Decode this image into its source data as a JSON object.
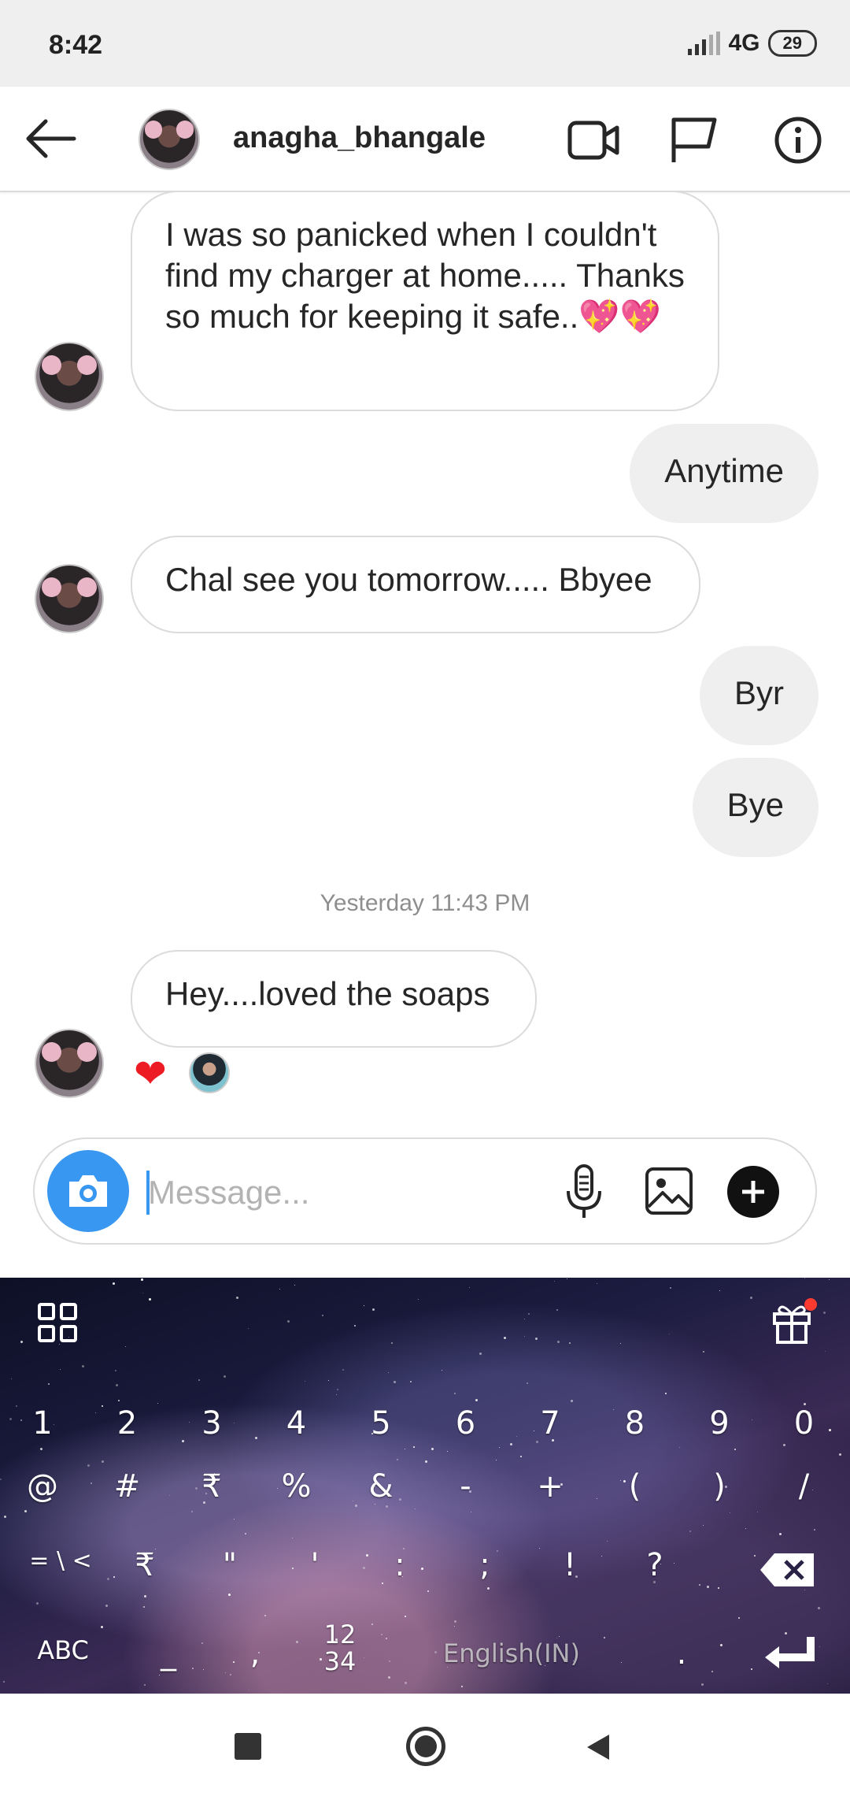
{
  "status_bar": {
    "time": "8:42",
    "network": "4G",
    "battery": "29"
  },
  "header": {
    "username": "anagha_bhangale"
  },
  "messages": [
    {
      "from": "them",
      "text": "I was so panicked when I couldn't find my charger at home..... Thanks so much for keeping it safe..💖💖"
    },
    {
      "from": "me",
      "text": "Anytime"
    },
    {
      "from": "them",
      "text": "Chal see you tomorrow..... Bbyee"
    },
    {
      "from": "me",
      "text": "Byr"
    },
    {
      "from": "me",
      "text": "Bye"
    },
    {
      "from": "them",
      "text": "Hey....loved the soaps"
    }
  ],
  "timestamp": "Yesterday 11:43 PM",
  "reaction": {
    "emoji": "❤"
  },
  "composer": {
    "placeholder": "Message..."
  },
  "keyboard": {
    "row_numbers": [
      "1",
      "2",
      "3",
      "4",
      "5",
      "6",
      "7",
      "8",
      "9",
      "0"
    ],
    "row_symbols1": [
      "@",
      "#",
      "₹",
      "%",
      "&",
      "-",
      "+",
      "(",
      ")",
      "/"
    ],
    "row_symbols2": [
      "= \\ <",
      "₹",
      "\"",
      "'",
      ":",
      ";",
      "!",
      "?"
    ],
    "bottom": {
      "abc": "ABC",
      "underscore": "_",
      "comma": ",",
      "numpad_top": "12",
      "numpad_bottom": "34",
      "language": "English(IN)",
      "period": "."
    }
  },
  "colors": {
    "accent": "#3897f0",
    "heart": "#ed1c24",
    "bubble_out": "#efefef"
  },
  "icons": [
    "back-arrow-icon",
    "video-call-icon",
    "flag-icon",
    "info-icon",
    "camera-icon",
    "microphone-icon",
    "gallery-icon",
    "plus-icon",
    "grid-icon",
    "gift-icon",
    "backspace-icon",
    "enter-icon",
    "nav-square-icon",
    "nav-home-icon",
    "nav-back-icon"
  ]
}
